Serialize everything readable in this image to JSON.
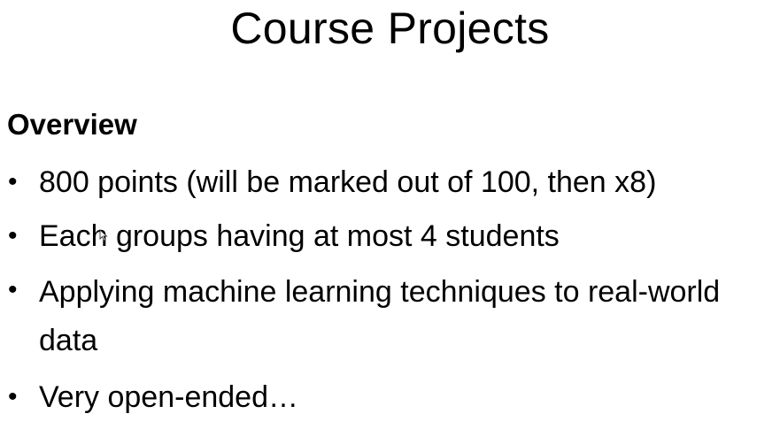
{
  "slide": {
    "title": "Course Projects",
    "section_heading": "Overview",
    "bullets": [
      {
        "text": "800 points (will be marked out of 100, then x8)"
      },
      {
        "text": "Each groups having at most 4 students"
      },
      {
        "text": "Applying machine learning techniques to real-world data"
      },
      {
        "text": "Very open-ended…"
      }
    ],
    "bullet_glyph": "•",
    "cursor_icon": "mouse-pointer-icon"
  }
}
